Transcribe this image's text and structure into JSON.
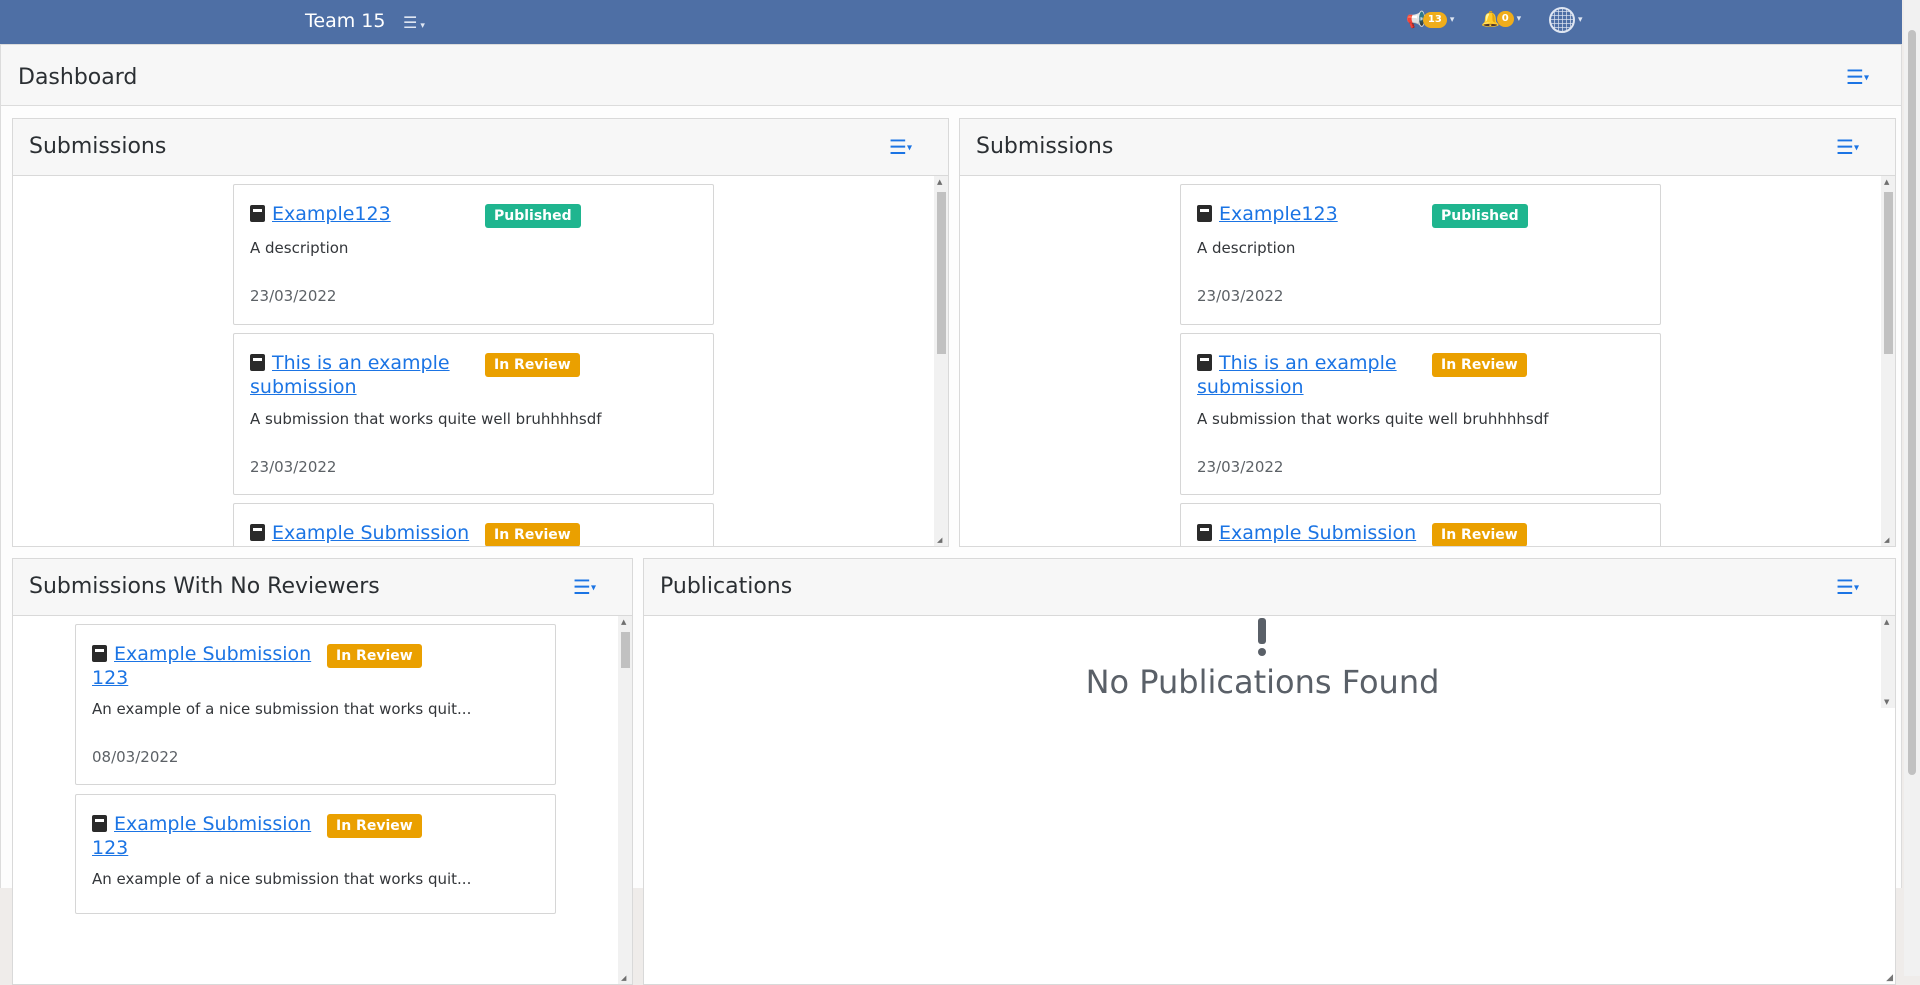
{
  "navbar": {
    "brand": "Team 15",
    "menu_icon": "hamburger-icon",
    "announcements_count": "13",
    "notifications_count": "0"
  },
  "dashboard": {
    "title": "Dashboard"
  },
  "widgets": {
    "submissions_left": {
      "title": "Submissions",
      "cards": [
        {
          "title": "Example123",
          "status": "Published",
          "description": "A description",
          "date": "23/03/2022"
        },
        {
          "title": "This is an example submission",
          "title_line1": "This is an example",
          "title_line2": "submission",
          "status": "In Review",
          "description": "A submission that works quite well bruhhhhsdf",
          "date": "23/03/2022"
        },
        {
          "title": "Example Submission",
          "status": "In Review"
        }
      ]
    },
    "submissions_right": {
      "title": "Submissions",
      "cards": [
        {
          "title": "Example123",
          "status": "Published",
          "description": "A description",
          "date": "23/03/2022"
        },
        {
          "title": "This is an example submission",
          "title_line1": "This is an example",
          "title_line2": "submission",
          "status": "In Review",
          "description": "A submission that works quite well bruhhhhsdf",
          "date": "23/03/2022"
        },
        {
          "title": "Example Submission",
          "status": "In Review"
        }
      ]
    },
    "no_reviewers": {
      "title": "Submissions With No Reviewers",
      "cards": [
        {
          "title_line1": "Example Submission",
          "title_line2": "123",
          "status": "In Review",
          "description": "An example of a nice submission that works quit...",
          "date": "08/03/2022"
        },
        {
          "title_line1": "Example Submission",
          "title_line2": "123",
          "status": "In Review",
          "description": "An example of a nice submission that works quit..."
        }
      ]
    },
    "publications": {
      "title": "Publications",
      "empty_message": "No Publications Found",
      "empty_icon": "exclamation-icon"
    }
  },
  "colors": {
    "navbar": "#4e6fa5",
    "published": "#1fb58f",
    "in_review": "#eaa000",
    "link": "#1b74e4"
  }
}
